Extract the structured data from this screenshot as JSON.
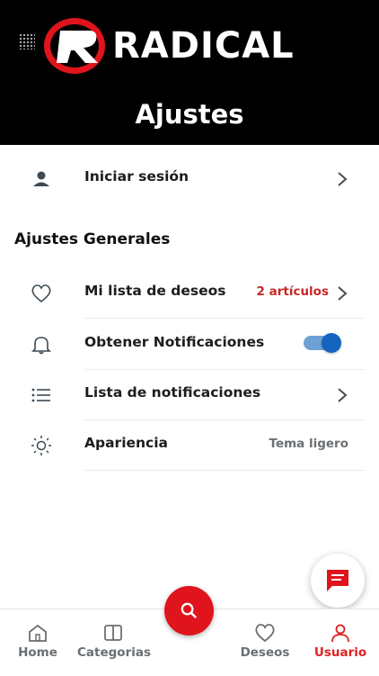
{
  "brand": {
    "logo_text": "RADICAL"
  },
  "header": {
    "title": "Ajustes"
  },
  "login": {
    "label": "Iniciar sesión"
  },
  "section": {
    "title": "Ajustes Generales"
  },
  "items": [
    {
      "label": "Mi lista de deseos",
      "value": "2 artículos",
      "value_color": "#c62828",
      "icon": "heart-icon"
    },
    {
      "label": "Obtener Notificaciones",
      "toggle_on": true,
      "icon": "bell-icon"
    },
    {
      "label": "Lista de notificaciones",
      "icon": "list-icon"
    },
    {
      "label": "Apariencia",
      "value": "Tema ligero",
      "icon": "sun-icon"
    }
  ],
  "tabs": [
    {
      "label": "Home",
      "icon": "home-icon"
    },
    {
      "label": "Categorias",
      "icon": "categories-icon"
    },
    {
      "label": "Deseos",
      "icon": "heart-icon"
    },
    {
      "label": "Usuario",
      "icon": "user-icon",
      "active": true
    }
  ],
  "colors": {
    "accent": "#e0141c",
    "toggle": "#1565c0",
    "header_bg": "#000000"
  }
}
